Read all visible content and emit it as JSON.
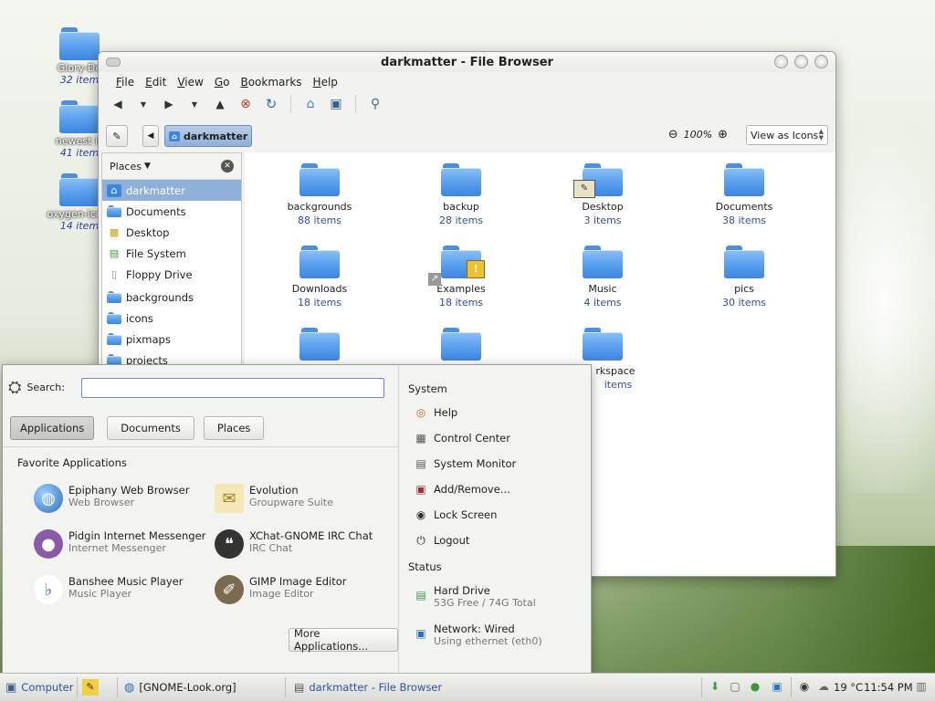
{
  "desktop": {
    "icons": [
      {
        "name": "Glory-De",
        "count": "32 item"
      },
      {
        "name": "newest ic",
        "count": "41 item"
      },
      {
        "name": "oxygen-icon-",
        "count": "14 item"
      }
    ]
  },
  "window": {
    "title": "darkmatter - File Browser",
    "menu": [
      "File",
      "Edit",
      "View",
      "Go",
      "Bookmarks",
      "Help"
    ],
    "location": {
      "current": "darkmatter"
    },
    "zoom": "100%",
    "view_mode": "View as Icons",
    "sidebar": {
      "header": "Places",
      "items": [
        {
          "label": "darkmatter",
          "icon": "home-icon",
          "selected": true
        },
        {
          "label": "Documents",
          "icon": "folder-icon"
        },
        {
          "label": "Desktop",
          "icon": "desktop-icon"
        },
        {
          "label": "File System",
          "icon": "harddisk-icon"
        },
        {
          "label": "Floppy Drive",
          "icon": "floppy-icon"
        },
        {
          "label": "backgrounds",
          "icon": "folder-icon"
        },
        {
          "label": "icons",
          "icon": "folder-icon"
        },
        {
          "label": "pixmaps",
          "icon": "folder-icon"
        },
        {
          "label": "projects",
          "icon": "folder-icon"
        }
      ]
    },
    "files": [
      {
        "name": "backgrounds",
        "count": "88 items"
      },
      {
        "name": "backup",
        "count": "28 items"
      },
      {
        "name": "Desktop",
        "count": "3 items"
      },
      {
        "name": "Documents",
        "count": "38 items"
      },
      {
        "name": "Downloads",
        "count": "18 items"
      },
      {
        "name": "Examples",
        "count": "18 items"
      },
      {
        "name": "Music",
        "count": "4 items"
      },
      {
        "name": "pics",
        "count": "30 items"
      },
      {
        "name": "rkspace",
        "count": "items"
      }
    ]
  },
  "menu": {
    "search_label": "Search:",
    "search_value": "",
    "tabs": [
      "Applications",
      "Documents",
      "Places"
    ],
    "favorites_title": "Favorite Applications",
    "apps": [
      {
        "name": "Epiphany Web Browser",
        "desc": "Web Browser"
      },
      {
        "name": "Evolution",
        "desc": "Groupware Suite"
      },
      {
        "name": "Pidgin Internet Messenger",
        "desc": "Internet Messenger"
      },
      {
        "name": "XChat-GNOME IRC Chat",
        "desc": "IRC Chat"
      },
      {
        "name": "Banshee Music Player",
        "desc": "Music Player"
      },
      {
        "name": "GIMP Image Editor",
        "desc": "Image Editor"
      }
    ],
    "more_apps": "More Applications...",
    "system_title": "System",
    "system_items": [
      "Help",
      "Control Center",
      "System Monitor",
      "Add/Remove...",
      "Lock Screen",
      "Logout"
    ],
    "status_title": "Status",
    "status": [
      {
        "name": "Hard Drive",
        "desc": "53G Free / 74G Total"
      },
      {
        "name": "Network: Wired",
        "desc": "Using ethernet (eth0)"
      }
    ]
  },
  "panel": {
    "computer": "Computer",
    "tasks": [
      "[GNOME-Look.org]",
      "darkmatter - File Browser"
    ],
    "temperature": "19 °C",
    "clock": "11:54 PM"
  }
}
